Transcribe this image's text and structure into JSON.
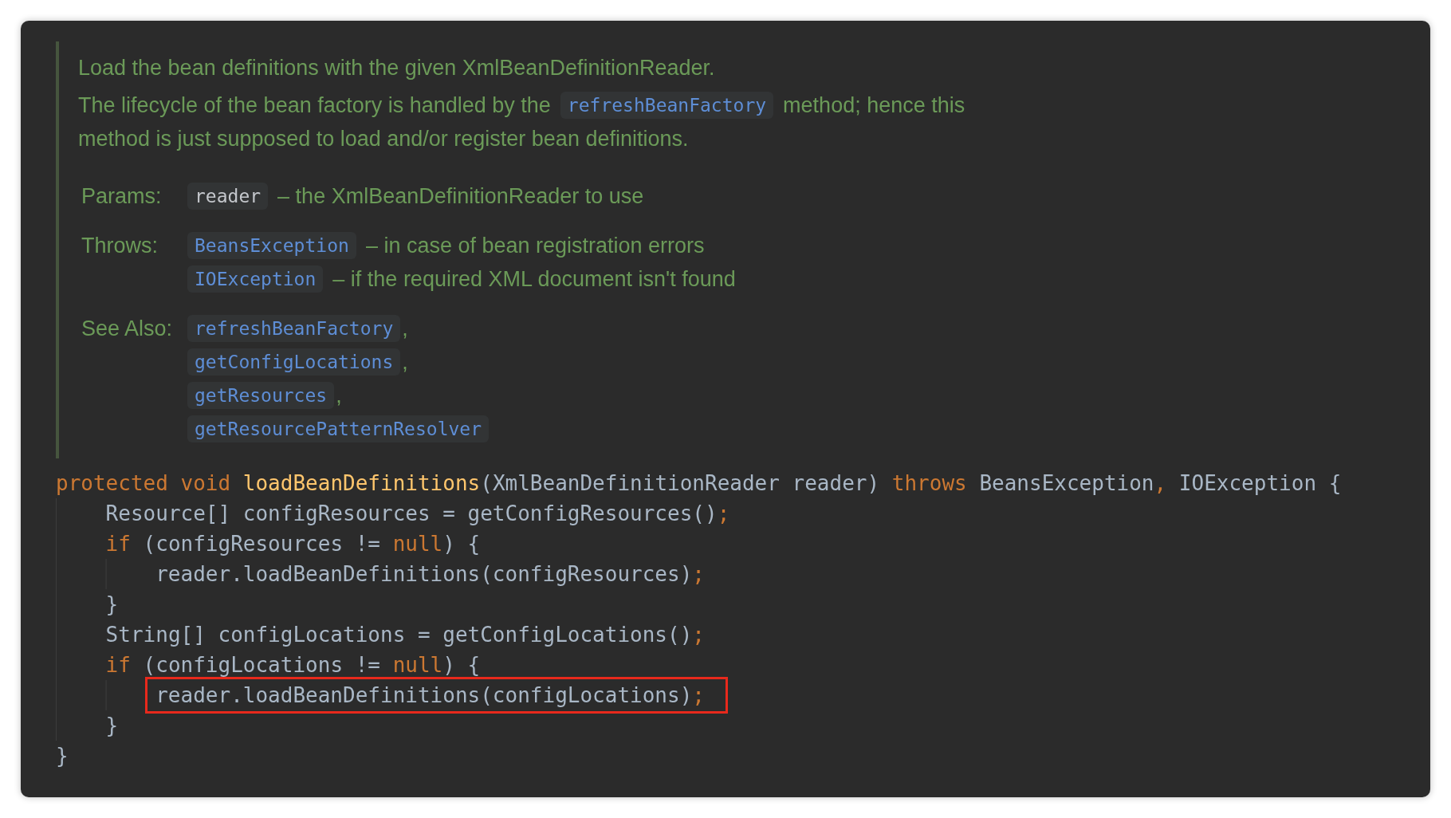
{
  "doc": {
    "lines": [
      [
        {
          "kind": "text",
          "text": "Load the bean definitions with the given XmlBeanDefinitionReader."
        }
      ],
      [
        {
          "kind": "text",
          "text": "The lifecycle of the bean factory is handled by the"
        },
        {
          "kind": "link",
          "text": "refreshBeanFactory"
        },
        {
          "kind": "text",
          "text": "method; hence this"
        }
      ],
      [
        {
          "kind": "text",
          "text": "method is just supposed to load and/or register bean definitions."
        }
      ]
    ],
    "sections": [
      {
        "label": "Params:",
        "entries": [
          [
            {
              "kind": "param",
              "text": "reader"
            },
            {
              "kind": "text",
              "text": "– the XmlBeanDefinitionReader to use"
            }
          ]
        ]
      },
      {
        "label": "Throws:",
        "entries": [
          [
            {
              "kind": "link",
              "text": "BeansException"
            },
            {
              "kind": "text",
              "text": "– in case of bean registration errors"
            }
          ],
          [
            {
              "kind": "link",
              "text": "IOException"
            },
            {
              "kind": "text",
              "text": "– if the required XML document isn't found"
            }
          ]
        ]
      },
      {
        "label": "See Also:",
        "entries": [
          [
            {
              "kind": "link",
              "text": "refreshBeanFactory"
            },
            {
              "kind": "comma",
              "text": ","
            }
          ],
          [
            {
              "kind": "link",
              "text": "getConfigLocations"
            },
            {
              "kind": "comma",
              "text": ","
            }
          ],
          [
            {
              "kind": "link",
              "text": "getResources"
            },
            {
              "kind": "comma",
              "text": ","
            }
          ],
          [
            {
              "kind": "link",
              "text": "getResourcePatternResolver"
            }
          ]
        ]
      }
    ]
  },
  "code": [
    {
      "highlighted": false,
      "tokens": [
        {
          "kind": "keyword",
          "text": "protected void "
        },
        {
          "kind": "method",
          "text": "loadBeanDefinitions"
        },
        {
          "kind": "plain",
          "text": "(XmlBeanDefinitionReader reader) "
        },
        {
          "kind": "keyword",
          "text": "throws "
        },
        {
          "kind": "plain",
          "text": "BeansException"
        },
        {
          "kind": "keyword",
          "text": ", "
        },
        {
          "kind": "plain",
          "text": "IOException {"
        }
      ],
      "children": [
        {
          "highlighted": false,
          "tokens": [
            {
              "kind": "plain",
              "text": "Resource[] configResources = getConfigResources()"
            },
            {
              "kind": "keyword",
              "text": ";"
            }
          ]
        },
        {
          "highlighted": false,
          "tokens": [
            {
              "kind": "keyword",
              "text": "if "
            },
            {
              "kind": "plain",
              "text": "(configResources != "
            },
            {
              "kind": "keyword",
              "text": "null"
            },
            {
              "kind": "plain",
              "text": ") {"
            }
          ],
          "children": [
            {
              "highlighted": false,
              "tokens": [
                {
                  "kind": "plain",
                  "text": "reader.loadBeanDefinitions(configResources)"
                },
                {
                  "kind": "keyword",
                  "text": ";"
                }
              ]
            }
          ]
        },
        {
          "highlighted": false,
          "tokens": [
            {
              "kind": "plain",
              "text": "}"
            }
          ]
        },
        {
          "highlighted": false,
          "tokens": [
            {
              "kind": "plain",
              "text": "String[] configLocations = getConfigLocations()"
            },
            {
              "kind": "keyword",
              "text": ";"
            }
          ]
        },
        {
          "highlighted": false,
          "tokens": [
            {
              "kind": "keyword",
              "text": "if "
            },
            {
              "kind": "plain",
              "text": "(configLocations != "
            },
            {
              "kind": "keyword",
              "text": "null"
            },
            {
              "kind": "plain",
              "text": ") {"
            }
          ],
          "children": [
            {
              "highlighted": true,
              "tokens": [
                {
                  "kind": "plain",
                  "text": "reader.loadBeanDefinitions(configLocations)"
                },
                {
                  "kind": "keyword",
                  "text": ";"
                }
              ]
            }
          ]
        },
        {
          "highlighted": false,
          "tokens": [
            {
              "kind": "plain",
              "text": "}"
            }
          ]
        }
      ]
    },
    {
      "highlighted": false,
      "tokens": [
        {
          "kind": "plain",
          "text": "}"
        }
      ]
    }
  ]
}
